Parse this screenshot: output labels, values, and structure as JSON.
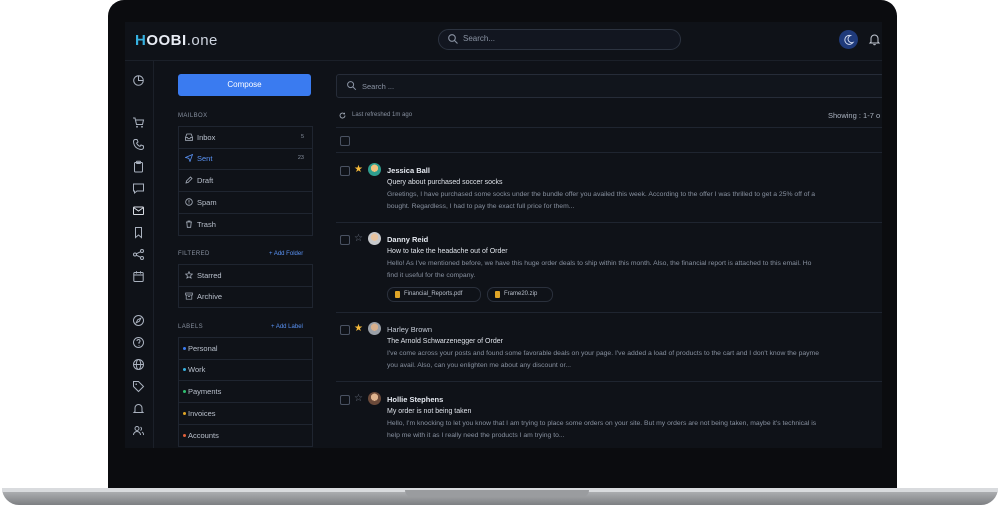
{
  "app": {
    "logo_prefix": "H",
    "logo_mid": "OOBI",
    "logo_suffix": ".one"
  },
  "topbar": {
    "search_placeholder": "Search..."
  },
  "compose": {
    "label": "Compose"
  },
  "mailbox": {
    "title": "MAILBOX",
    "items": [
      {
        "label": "Inbox",
        "count": "5",
        "icon": "inbox-icon"
      },
      {
        "label": "Sent",
        "count": "23",
        "icon": "send-icon"
      },
      {
        "label": "Draft",
        "count": "",
        "icon": "pencil-icon"
      },
      {
        "label": "Spam",
        "count": "",
        "icon": "alert-icon"
      },
      {
        "label": "Trash",
        "count": "",
        "icon": "trash-icon"
      }
    ]
  },
  "filtered": {
    "title": "FILTERED",
    "add_label": "Add Folder",
    "items": [
      {
        "label": "Starred",
        "icon": "star-icon"
      },
      {
        "label": "Archive",
        "icon": "archive-icon"
      }
    ]
  },
  "labels": {
    "title": "LABELS",
    "add_label": "Add Label",
    "items": [
      {
        "label": "Personal",
        "color": "#3a7bf0"
      },
      {
        "label": "Work",
        "color": "#36b1e0"
      },
      {
        "label": "Payments",
        "color": "#2fbf71"
      },
      {
        "label": "Invoices",
        "color": "#e0a526"
      },
      {
        "label": "Accounts",
        "color": "#e0603a"
      }
    ]
  },
  "main": {
    "search_placeholder": "Search ...",
    "refresh_text": "Last refreshed 1m ago",
    "showing_text": "Showing : 1-7 o"
  },
  "mails": [
    {
      "sender": "Jessica Ball",
      "starred": true,
      "unread": true,
      "subject": "Query about purchased soccer socks",
      "line1": "Greetings, I have purchased some socks under the bundle offer you availed this week. According to the offer I was thrilled to get a 25% off of a",
      "line2": "bought. Regardless, I had to pay the exact full price for them...",
      "attachments": []
    },
    {
      "sender": "Danny Reid",
      "starred": false,
      "unread": true,
      "subject": "How to take the headache out of Order",
      "line1": "Hello! As I've mentioned before, we have this huge order deals to ship within this month. Also, the financial report is attached to this email. Ho",
      "line2": "find it useful for the company.",
      "attachments": [
        "Financial_Reports.pdf",
        "Frame20.zip"
      ]
    },
    {
      "sender": "Harley Brown",
      "starred": true,
      "unread": false,
      "subject": "The Arnold Schwarzenegger of Order",
      "line1": "I've come across your posts and found some favorable deals on your page. I've added a load of products to the cart and I don't know the payme",
      "line2": "you avail. Also, can you enlighten me about any discount or...",
      "attachments": []
    },
    {
      "sender": "Hollie Stephens",
      "starred": false,
      "unread": true,
      "subject": "My order is not being taken",
      "line1": "Hello, I'm knocking to let you know that I am trying to place some orders on your site. But my orders are not being taken, maybe it's technical is",
      "line2": "help me with it as I really need the products I am trying to...",
      "attachments": []
    }
  ],
  "colors": {
    "accent": "#3a7bf0",
    "star": "#f5b93a",
    "bg": "#0f1218"
  }
}
